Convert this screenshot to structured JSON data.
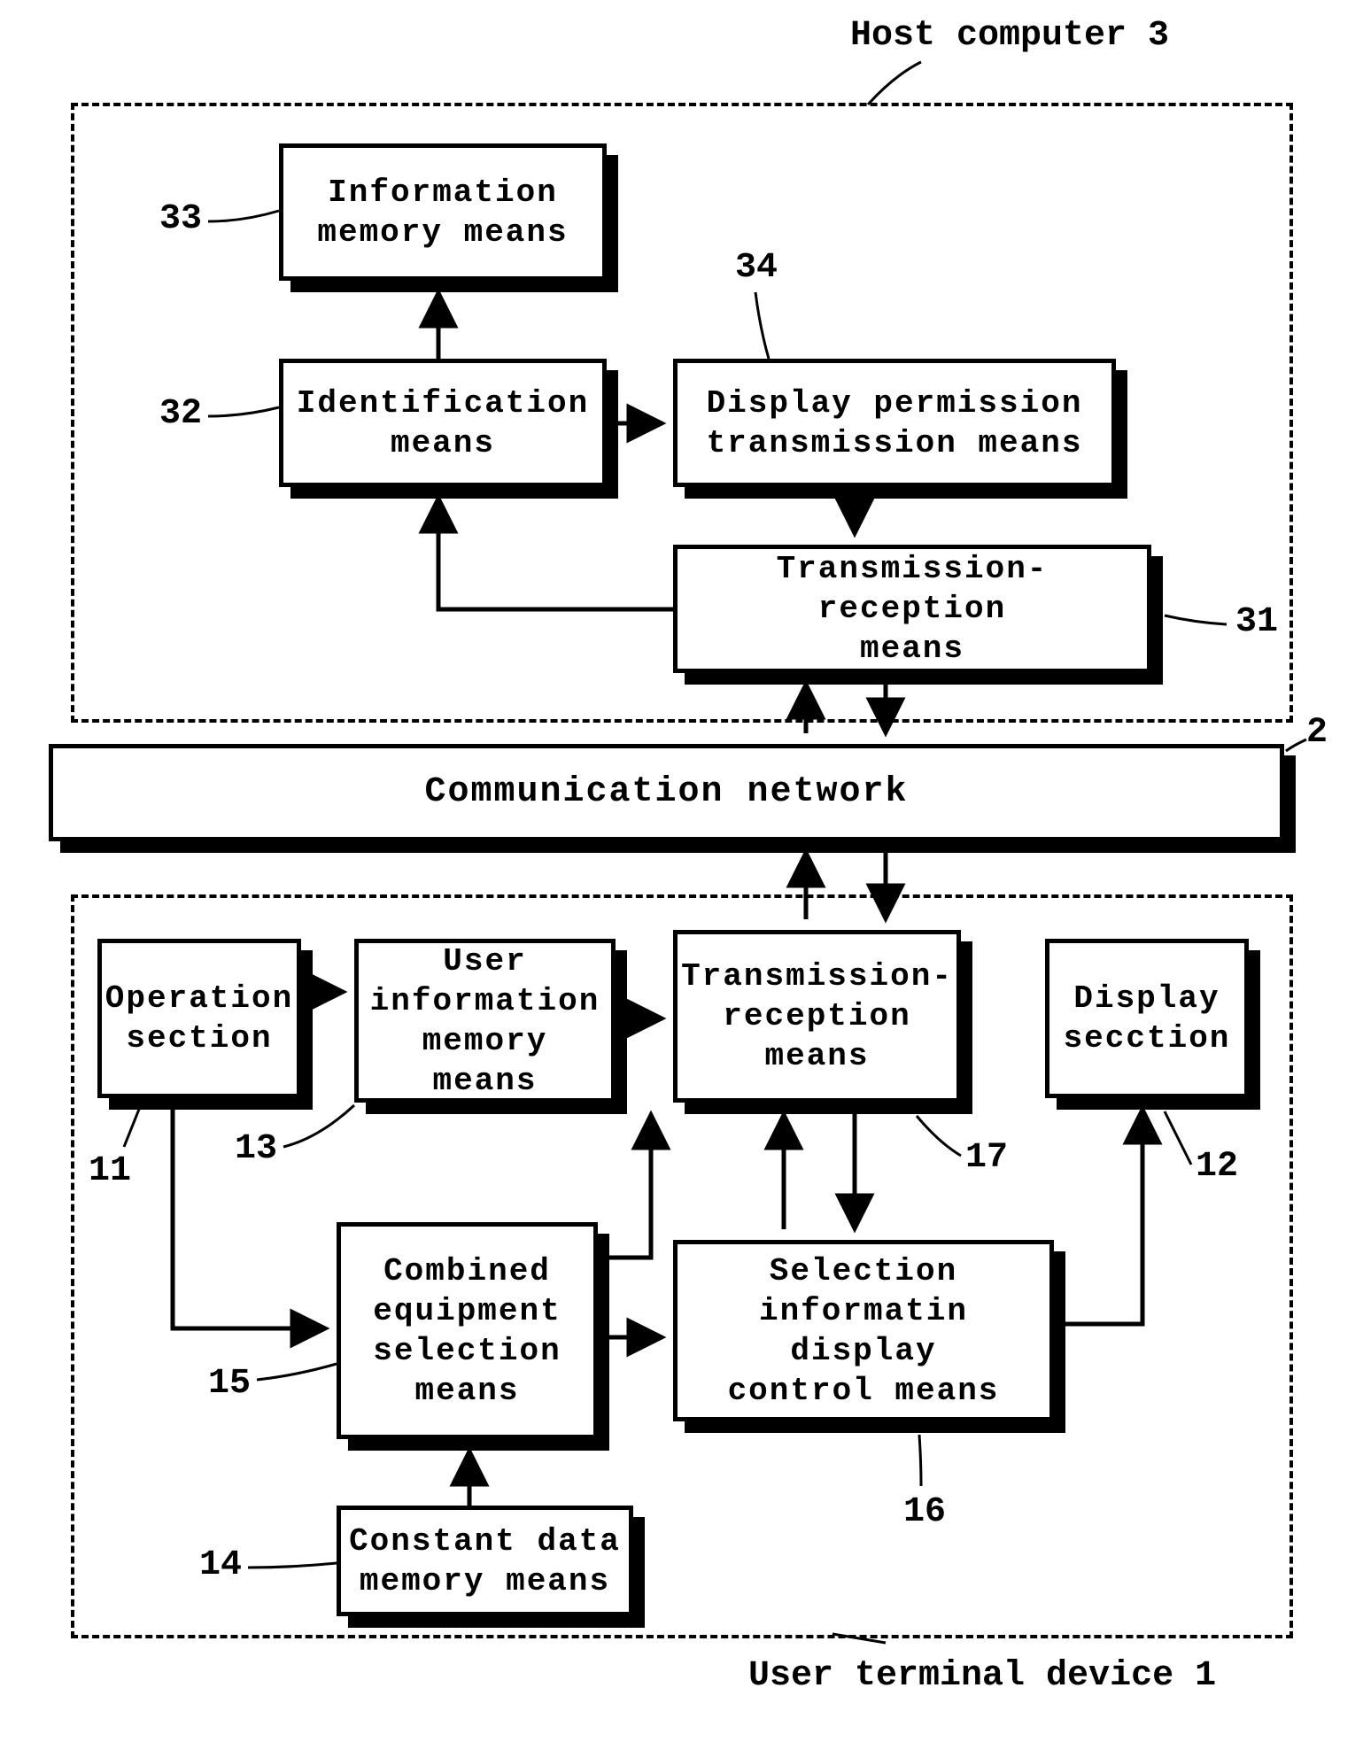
{
  "labels": {
    "hostComputer": "Host computer 3",
    "userTerminal": "User terminal device 1",
    "n33": "33",
    "n32": "32",
    "n34": "34",
    "n31": "31",
    "n2": "2",
    "n11": "11",
    "n12": "12",
    "n13": "13",
    "n14": "14",
    "n15": "15",
    "n16": "16",
    "n17": "17"
  },
  "boxes": {
    "infoMemory": "Information\nmemory means",
    "identification": "Identification\nmeans",
    "displayPermission": "Display permission\ntransmission means",
    "transRecepHost": "Transmission-reception\nmeans",
    "commNetwork": "Communication network",
    "operation": "Operation\nsection",
    "userInfoMemory": "User\ninformation\nmemory means",
    "transRecepUser": "Transmission-\nreception\nmeans",
    "displaySection": "Display\nsecction",
    "combinedEquip": "Combined\nequipment\nselection\nmeans",
    "selectionInfo": "Selection\ninformatin display\ncontrol means",
    "constantData": "Constant data\nmemory means"
  }
}
